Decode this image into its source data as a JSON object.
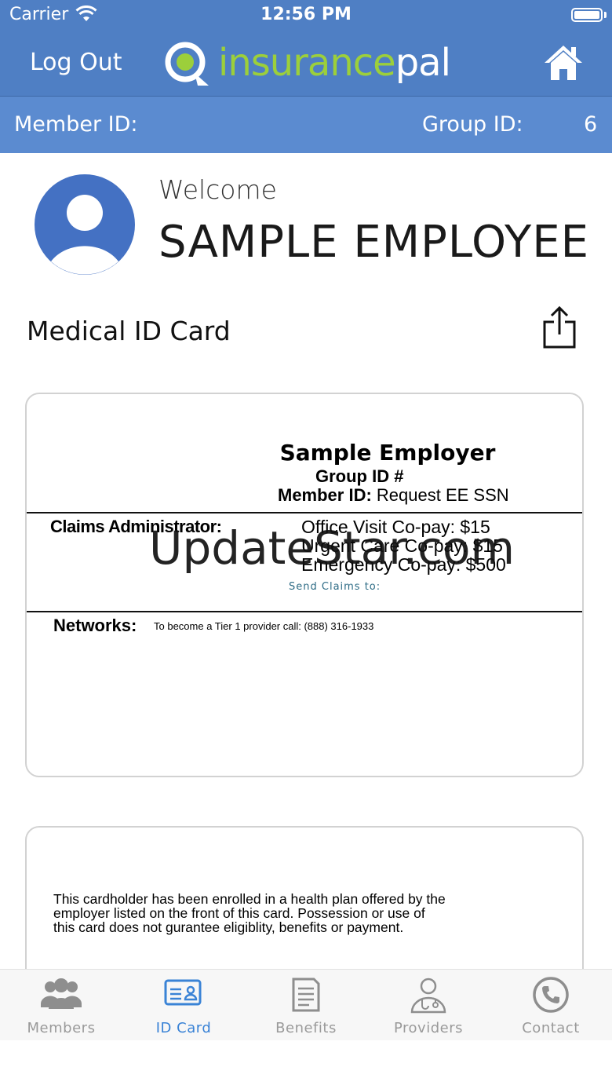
{
  "status_bar": {
    "carrier": "Carrier",
    "time": "12:56 PM"
  },
  "nav": {
    "logout_label": "Log Out",
    "logo_part1": "insurance",
    "logo_part2": "pal",
    "home_icon": "home-icon"
  },
  "id_bar": {
    "member_id_label": "Member ID:",
    "group_id_label": "Group ID:",
    "group_id_value": "6"
  },
  "welcome": {
    "greeting": "Welcome",
    "name": "SAMPLE EMPLOYEE"
  },
  "card_section": {
    "title": "Medical ID Card"
  },
  "card_front": {
    "employer": "Sample Employer",
    "group_id_label": "Group ID #",
    "member_id_label": "Member ID:",
    "member_id_value": "Request EE SSN",
    "claims_admin_label": "Claims Administrator:",
    "office_visit": "Office Visit Co-pay:  $15",
    "urgent_care": "Urgent Care Co-pay:  $15",
    "emergency": "Emergency Co-pay:  $500",
    "send_claims": "Send Claims to:",
    "networks_label": "Networks:",
    "tier_text": "To become a Tier 1 provider call: (888) 316-1933"
  },
  "card_back": {
    "disclaimer": "This cardholder has been enrolled in a health plan offered by the employer listed on the front of this card. Possession or use of this card does not gurantee eligiblity, benefits or payment."
  },
  "watermark": "UpdateStar.com",
  "tabs": [
    {
      "label": "Members",
      "icon": "members-icon",
      "active": false
    },
    {
      "label": "ID Card",
      "icon": "id-card-icon",
      "active": true
    },
    {
      "label": "Benefits",
      "icon": "benefits-icon",
      "active": false
    },
    {
      "label": "Providers",
      "icon": "providers-icon",
      "active": false
    },
    {
      "label": "Contact",
      "icon": "phone-icon",
      "active": false
    }
  ],
  "colors": {
    "header_blue": "#4f7fc4",
    "id_bar_blue": "#5b8bd0",
    "logo_green": "#9ccf3b",
    "tab_active": "#3a83d6",
    "tab_inactive": "#9a9a9a"
  }
}
